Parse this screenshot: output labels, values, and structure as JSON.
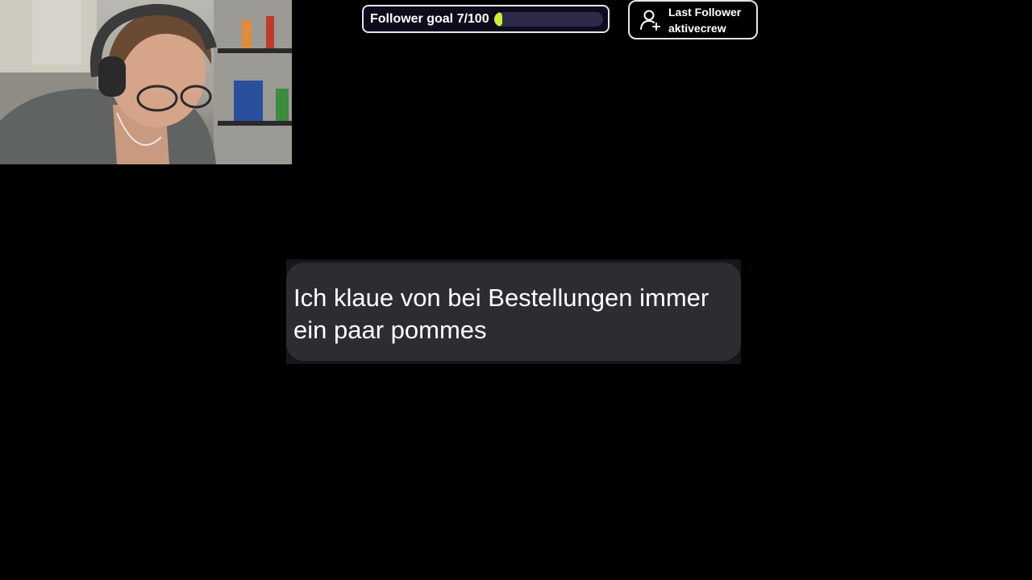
{
  "goal": {
    "label": "Follower goal 7/100",
    "current": 7,
    "target": 100,
    "progress_fraction": 0.07,
    "fill_color": "#c9f230",
    "track_color": "#2e2a4a"
  },
  "last_follower": {
    "title": "Last Follower",
    "name": "aktivecrew",
    "icon": "user-plus-icon"
  },
  "message": {
    "text": "Ich klaue von bei Bestellungen immer ein paar pommes"
  },
  "webcam": {
    "icon": "webcam-feed"
  }
}
